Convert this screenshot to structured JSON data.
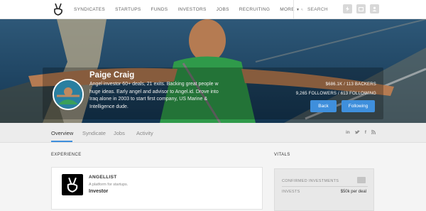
{
  "nav": {
    "items": [
      "SYNDICATES",
      "STARTUPS",
      "FUNDS",
      "INVESTORS",
      "JOBS",
      "RECRUITING",
      "MORE"
    ],
    "search_placeholder": "SEARCH"
  },
  "profile": {
    "name": "Paige Craig",
    "bio": "Angel investor 60+ deals, 21 exits. Backing great people w huge ideas. Early angel and advisor to Angel.id. Drove into Iraq alone in 2003 to start first company, US Marine & Intelligence dude.",
    "stat_backing": "$686.1K / 113 BACKERS",
    "stat_followers": "9,265 FOLLOWERS / 613 FOLLOWING",
    "back_label": "Back",
    "following_label": "Following"
  },
  "tabs": [
    "Overview",
    "Syndicate",
    "Jobs",
    "Activity"
  ],
  "social_icons": [
    "in",
    "t",
    "f",
    "rss"
  ],
  "experience": {
    "heading": "EXPERIENCE",
    "company": "ANGELLIST",
    "description": "A platform for startups.",
    "role": "Investor"
  },
  "vitals": {
    "heading": "VITALS",
    "confirmed_label": "CONFIRMED INVESTMENTS",
    "invests_label": "INVESTS",
    "invests_value": "$50k per deal"
  },
  "colors": {
    "accent": "#3f8fdc",
    "nav_bg": "#ffffff",
    "page_bg": "#f4f4f4"
  }
}
